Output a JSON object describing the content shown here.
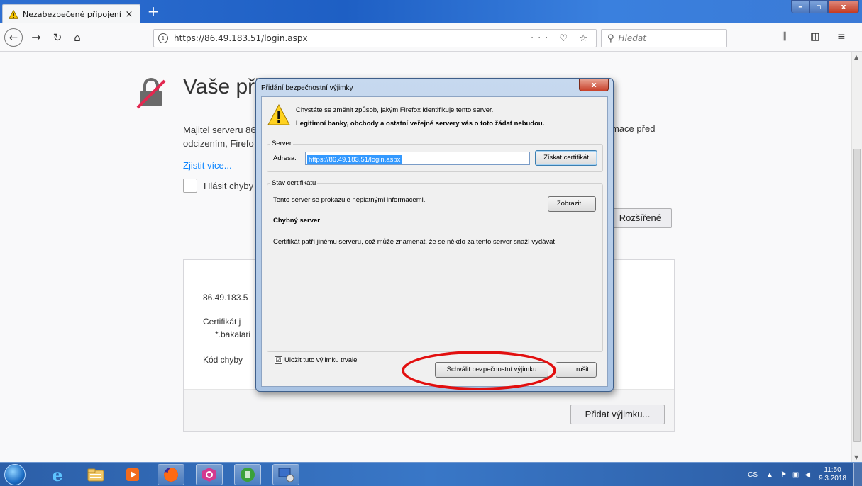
{
  "browser": {
    "tab_title": "Nezabezpečené připojení",
    "tab_close": "×",
    "new_tab": "+",
    "url": "https://86.49.183.51/login.aspx",
    "url_actions": "··· ♡ ☆",
    "search_placeholder": "Hledat",
    "window_controls": {
      "min": "–",
      "max": "▫",
      "close": "x"
    }
  },
  "page": {
    "title": "Vaše při",
    "text_line1": "Majitel serveru 86",
    "text_line2": "odcizením, Firefo",
    "text_line1_right": "mace před",
    "learn_more": "Zjistit více...",
    "report_label": "Hlásit chyby",
    "advanced_button": "Rozšířené",
    "adv_host": "86.49.183.5",
    "adv_cert": "Certifikát j",
    "adv_cert_domain": "*.bakalari",
    "adv_code": "Kód chyby",
    "add_exception_button": "Přidat výjimku..."
  },
  "dialog": {
    "title": "Přidání bezpečnostní výjimky",
    "close": "x",
    "message": "Chystáte se změnit způsob, jakým Firefox identifikuje tento server.",
    "message_bold": "Legitimní banky, obchody a ostatní veřejné servery vás o toto žádat nebudou.",
    "server_group": "Server",
    "address_label": "Adresa:",
    "address_value": "https://86.49.183.51/login.aspx",
    "get_cert_button": "Získat certifikát",
    "cert_group": "Stav certifikátu",
    "cert_status": "Tento server se prokazuje neplatnými informacemi.",
    "view_button": "Zobrazit...",
    "wrong_server_heading": "Chybný server",
    "wrong_server_text": "Certifikát patří jinému serveru, což může znamenat, že se někdo za tento server snaží vydávat.",
    "save_permanently": "Uložit tuto výjimku trvale",
    "save_checked": "☑",
    "confirm_button": "Schválit bezpečnostní výjimku",
    "cancel_button": "rušit"
  },
  "taskbar": {
    "lang": "CS",
    "time": "11:50",
    "date": "9.3.2018"
  }
}
